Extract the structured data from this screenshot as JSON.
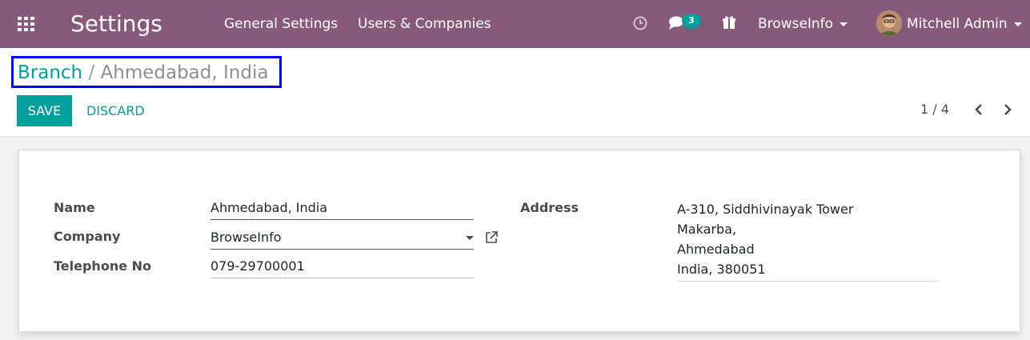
{
  "navbar": {
    "app_title": "Settings",
    "menu": [
      "General Settings",
      "Users & Companies"
    ],
    "chat_badge_count": "3",
    "company": "BrowseInfo",
    "user_name": "Mitchell Admin",
    "icons": [
      "apps-grid-icon",
      "clock-icon",
      "chat-icon",
      "gift-icon"
    ],
    "color": "#875a7b"
  },
  "breadcrumb": {
    "parent": "Branch",
    "separator": "/",
    "current": "Ahmedabad, India"
  },
  "buttons": {
    "save": "Save",
    "discard": "Discard"
  },
  "pager": {
    "value": "1 / 4"
  },
  "form": {
    "labels": {
      "name": "Name",
      "company": "Company",
      "telephone": "Telephone No",
      "address": "Address"
    },
    "values": {
      "name": "Ahmedabad, India",
      "company": "BrowseInfo",
      "telephone": "079-29700001",
      "address_lines": [
        "A-310, Siddhivinayak Tower",
        "Makarba,",
        "Ahmedabad",
        "India, 380051"
      ]
    }
  },
  "accent_color": "#00a09d"
}
